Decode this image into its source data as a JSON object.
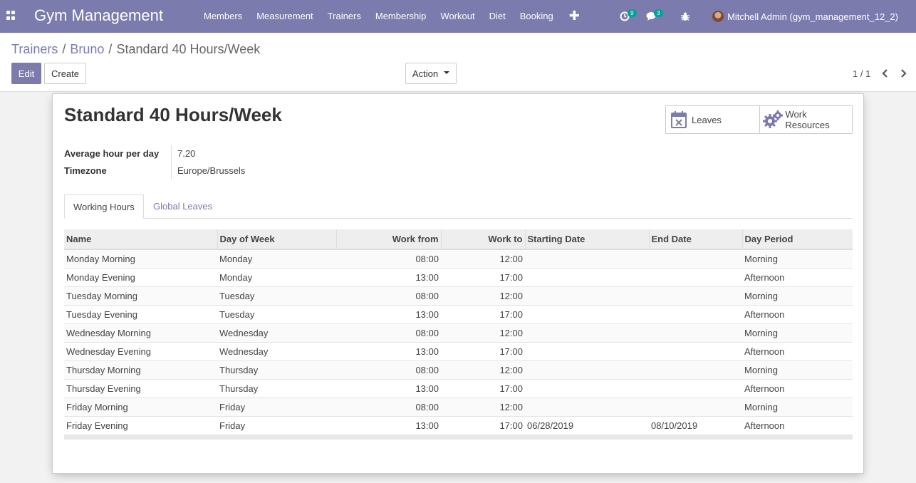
{
  "nav": {
    "brand": "Gym Management",
    "menu": [
      "Members",
      "Measurement",
      "Trainers",
      "Membership",
      "Workout",
      "Diet",
      "Booking"
    ],
    "plus_label": "✚",
    "activity_count": "9",
    "message_count": "3",
    "user": "Mitchell Admin (gym_management_12_2)"
  },
  "breadcrumb": {
    "items": [
      "Trainers",
      "Bruno"
    ],
    "current": "Standard 40 Hours/Week"
  },
  "controls": {
    "edit_label": "Edit",
    "create_label": "Create",
    "action_label": "Action",
    "pager": "1 / 1"
  },
  "record": {
    "title": "Standard 40 Hours/Week",
    "leaves_label": "Leaves",
    "work_resources_label_1": "Work",
    "work_resources_label_2": "Resources",
    "fields": [
      {
        "label": "Average hour per day",
        "value": "7.20"
      },
      {
        "label": "Timezone",
        "value": "Europe/Brussels"
      }
    ],
    "tabs": [
      "Working Hours",
      "Global Leaves"
    ]
  },
  "table": {
    "columns": [
      "Name",
      "Day of Week",
      "Work from",
      "Work to",
      "Starting Date",
      "End Date",
      "Day Period"
    ],
    "rows": [
      [
        "Monday Morning",
        "Monday",
        "08:00",
        "12:00",
        "",
        "",
        "Morning"
      ],
      [
        "Monday Evening",
        "Monday",
        "13:00",
        "17:00",
        "",
        "",
        "Afternoon"
      ],
      [
        "Tuesday Morning",
        "Tuesday",
        "08:00",
        "12:00",
        "",
        "",
        "Morning"
      ],
      [
        "Tuesday Evening",
        "Tuesday",
        "13:00",
        "17:00",
        "",
        "",
        "Afternoon"
      ],
      [
        "Wednesday Morning",
        "Wednesday",
        "08:00",
        "12:00",
        "",
        "",
        "Morning"
      ],
      [
        "Wednesday Evening",
        "Wednesday",
        "13:00",
        "17:00",
        "",
        "",
        "Afternoon"
      ],
      [
        "Thursday Morning",
        "Thursday",
        "08:00",
        "12:00",
        "",
        "",
        "Morning"
      ],
      [
        "Thursday Evening",
        "Thursday",
        "13:00",
        "17:00",
        "",
        "",
        "Afternoon"
      ],
      [
        "Friday Morning",
        "Friday",
        "08:00",
        "12:00",
        "",
        "",
        "Morning"
      ],
      [
        "Friday Evening",
        "Friday",
        "13:00",
        "17:00",
        "06/28/2019",
        "08/10/2019",
        "Afternoon"
      ]
    ]
  },
  "colors": {
    "brand": "#7c7bad",
    "badge": "#00a09d"
  }
}
